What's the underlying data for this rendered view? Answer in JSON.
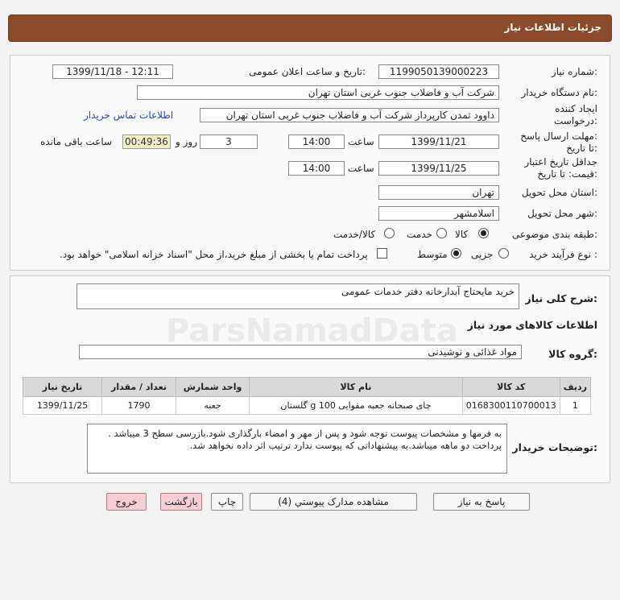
{
  "header": {
    "title": "جزئیات اطلاعات نیاز"
  },
  "labels": {
    "need_number": "شماره نیاز:",
    "announce_datetime": "تاریخ و ساعت اعلان عمومی:",
    "buyer_org": "نام دستگاه خریدار:",
    "creator_line1": "ایجاد کننده",
    "creator_line2": "درخواست:",
    "deadline_line1": "مهلت ارسال پاسخ:",
    "deadline_line2": "تا تاریخ:",
    "validity_line1": "جداقل تاریخ اعتبار",
    "validity_line2": "قیمت: تا تاریخ:",
    "province": "استان محل تحویل:",
    "city": "شهر محل تحویل:",
    "category": "طبقه بندی موضوعی:",
    "process": "نوع فرآیند خرید :",
    "hour": "ساعت",
    "day_and": "روز و",
    "remaining": "ساعت باقی مانده",
    "description": "شرح کلی نیاز:",
    "goods_info": "اطلاعات کالاهای مورد نیاز",
    "goods_group": "گروه کالا:",
    "buyer_notes": "توضیحات خریدار:"
  },
  "fields": {
    "need_number": "1199050139000223",
    "announce_datetime": "1399/11/18 - 12:11",
    "buyer_org": "شرکت آب و فاضلاب جنوب غربی استان تهران",
    "creator": "داوود  تمدن  کارپرداز شرکت آب و فاضلاب جنوب غربی استان تهران",
    "deadline_date": "1399/11/21",
    "deadline_time": "14:00",
    "days": "3",
    "remaining_time": "00:49:36",
    "validity_date": "1399/11/25",
    "validity_time": "14:00",
    "province": "تهران",
    "city": "اسلامشهر",
    "description": "خرید مایحتاج آبدارخانه دفتر خدمات عمومی",
    "goods_group": "مواد غذائی و نوشیدنی",
    "buyer_notes_line1": "به فرمها و مشخصات پیوست توجه شود و پس از مهر و امضاء بارگذاری شود.بازرسی سطح 3 میباشد .",
    "buyer_notes_line2": "پرداخت دو ماهه میباشد.به پیشنهاداتی که پیوست ندارد ترتیب اثر داده نخواهد شد."
  },
  "contact_link": "اطلاعات تماس خریدار",
  "category_options": [
    {
      "label": "کالا",
      "selected": true
    },
    {
      "label": "خدمت",
      "selected": false
    },
    {
      "label": "کالا/خدمت",
      "selected": false
    }
  ],
  "process_options": [
    {
      "label": "جزیی",
      "selected": false
    },
    {
      "label": "متوسط",
      "selected": true
    }
  ],
  "payment_note": "پرداخت تمام یا بخشی از مبلغ خرید،از محل \"اسناد خزانه اسلامی\" خواهد بود.",
  "table": {
    "headers": [
      "ردیف",
      "کد کالا",
      "نام کالا",
      "واحد شمارش",
      "تعداد / مقدار",
      "تاریخ نیاز"
    ],
    "rows": [
      [
        "1",
        "0168300110700013",
        "چای صبحانه جعبه مقوایی 100 g گلستان",
        "جعبه",
        "1790",
        "1399/11/25"
      ]
    ]
  },
  "buttons": {
    "reply": "پاسخ به نیاز",
    "attachments": "مشاهده مدارک پیوستي (4)",
    "print": "چاپ",
    "back": "بازگشت",
    "exit": "خروج"
  },
  "watermark": {
    "text": "ParsNamadData"
  }
}
